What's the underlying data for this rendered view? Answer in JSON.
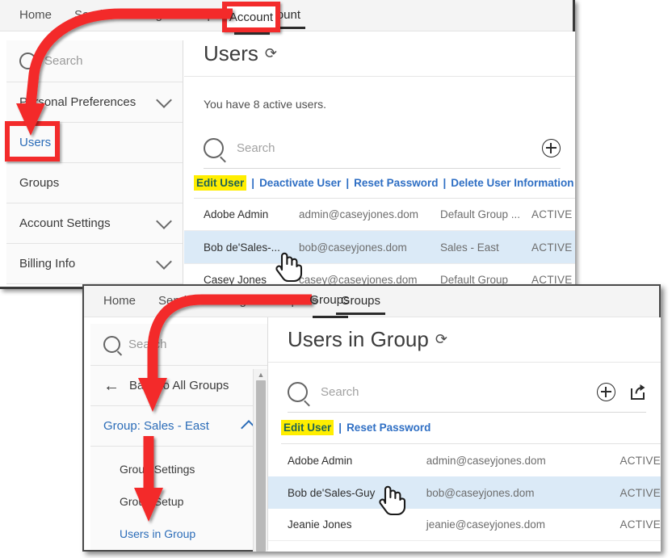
{
  "top_window": {
    "nav": {
      "items": [
        {
          "label": "Home",
          "active": false
        },
        {
          "label": "Send",
          "active": false
        },
        {
          "label": "Manage",
          "active": false
        },
        {
          "label": "Reports",
          "active": false
        },
        {
          "label": "Account",
          "active": true
        }
      ]
    },
    "sidebar": {
      "search_placeholder": "Search",
      "items": [
        {
          "label": "Personal Preferences",
          "chevron": "down",
          "highlighted": false
        },
        {
          "label": "Users",
          "chevron": "none",
          "highlighted": true
        },
        {
          "label": "Groups",
          "chevron": "none",
          "highlighted": false
        },
        {
          "label": "Account Settings",
          "chevron": "down",
          "highlighted": false
        },
        {
          "label": "Billing Info",
          "chevron": "down",
          "highlighted": false
        }
      ]
    },
    "main": {
      "title": "Users",
      "refresh_icon": "refresh-icon",
      "count_text": "You have 8 active users.",
      "search_placeholder": "Search",
      "add_icon": "plus-circle-icon",
      "actions": [
        {
          "label": "Edit User",
          "highlighted": true
        },
        {
          "label": "Deactivate User",
          "highlighted": false
        },
        {
          "label": "Reset Password",
          "highlighted": false
        },
        {
          "label": "Delete User Information",
          "highlighted": false
        }
      ],
      "action_separator": "|",
      "rows": [
        {
          "name": "Adobe Admin",
          "email": "admin@caseyjones.dom",
          "group": "Default Group ...",
          "status": "ACTIVE",
          "selected": false
        },
        {
          "name": "Bob de'Sales-...",
          "email": "bob@caseyjones.dom",
          "group": "Sales - East",
          "status": "ACTIVE",
          "selected": true
        },
        {
          "name": "Casey Jones",
          "email": "casey@caseyjones.dom",
          "group": "Default Group",
          "status": "ACTIVE",
          "selected": false
        }
      ]
    }
  },
  "bottom_window": {
    "nav": {
      "items": [
        {
          "label": "Home",
          "active": false
        },
        {
          "label": "Send",
          "active": false
        },
        {
          "label": "Manage",
          "active": false
        },
        {
          "label": "Reports",
          "active": false
        },
        {
          "label": "Groups",
          "active": true
        }
      ]
    },
    "sidebar": {
      "search_placeholder": "Search",
      "back_label": "Back to All Groups",
      "back_icon": "arrow-left-icon",
      "group_label": "Group: Sales - East",
      "group_chevron": "up",
      "sub_items": [
        {
          "label": "Group Settings",
          "highlighted": false
        },
        {
          "label": "Group Setup",
          "highlighted": false
        },
        {
          "label": "Users in Group",
          "highlighted": true
        }
      ]
    },
    "main": {
      "title": "Users in Group",
      "refresh_icon": "refresh-icon",
      "search_placeholder": "Search",
      "add_icon": "plus-circle-icon",
      "export_icon": "export-share-icon",
      "actions": [
        {
          "label": "Edit User",
          "highlighted": true
        },
        {
          "label": "Reset Password",
          "highlighted": false
        }
      ],
      "action_separator": "|",
      "rows": [
        {
          "name": "Adobe Admin",
          "email": "admin@caseyjones.dom",
          "status": "ACTIVE",
          "selected": false
        },
        {
          "name": "Bob de'Sales-Guy",
          "email": "bob@caseyjones.dom",
          "status": "ACTIVE",
          "selected": true
        },
        {
          "name": "Jeanie Jones",
          "email": "jeanie@caseyjones.dom",
          "status": "ACTIVE",
          "selected": false
        }
      ]
    }
  },
  "annotations": {
    "color": "#f32b2b",
    "highlight_color": "#ffee00",
    "boxes": [
      {
        "name": "account-tab-callout"
      },
      {
        "name": "users-sidebar-callout"
      },
      {
        "name": "groups-tab-callout"
      },
      {
        "name": "group-sales-east-callout"
      },
      {
        "name": "users-in-group-callout"
      }
    ],
    "arrows": [
      {
        "name": "account-to-users-arrow"
      },
      {
        "name": "groups-to-group-arrow"
      },
      {
        "name": "group-to-users-in-group-arrow"
      }
    ]
  }
}
